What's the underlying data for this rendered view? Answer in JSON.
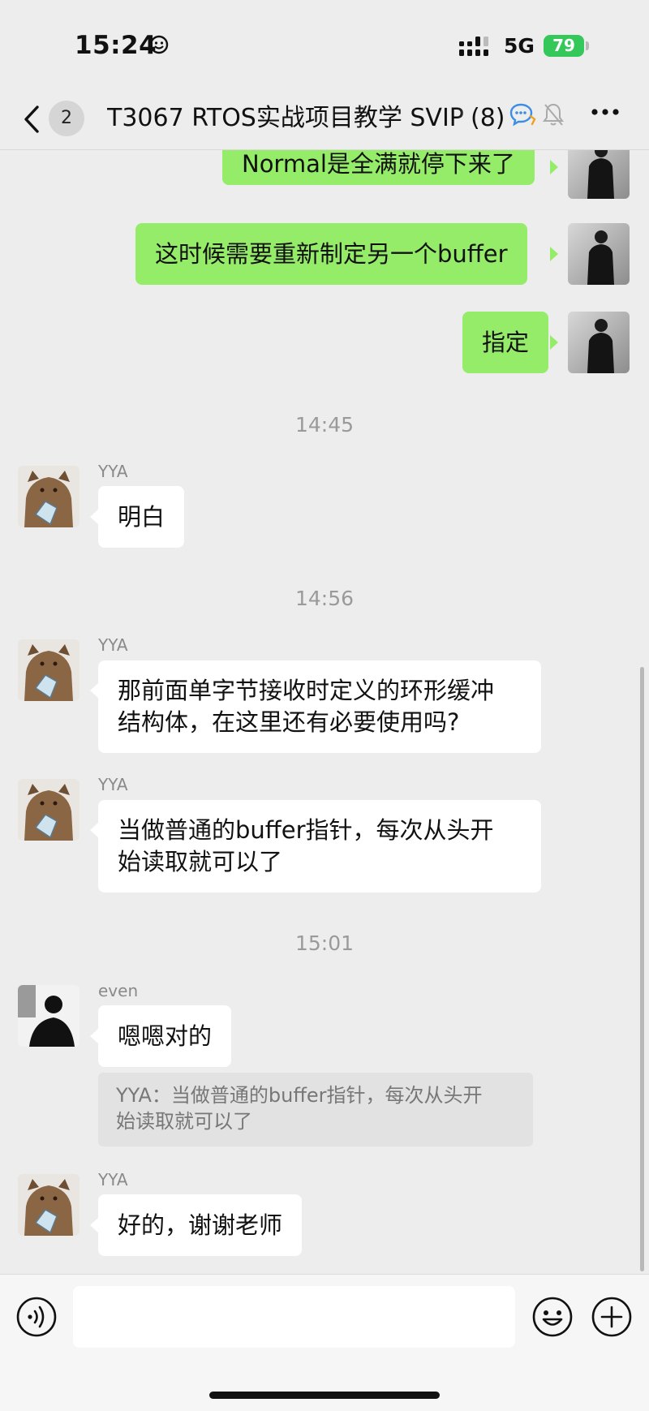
{
  "status_bar": {
    "time": "15:24",
    "network": "5G",
    "battery": "79"
  },
  "header": {
    "back_badge": "2",
    "title": "T3067 RTOS实战项目教学 SVIP",
    "member_count": "(8)"
  },
  "messages": [
    {
      "type": "out",
      "text": "Normal是全满就停下来了"
    },
    {
      "type": "out",
      "text": "这时候需要重新制定另一个buffer"
    },
    {
      "type": "out",
      "text": "指定"
    },
    {
      "type": "time",
      "text": "14:45"
    },
    {
      "type": "in",
      "sender": "YYA",
      "text": "明白"
    },
    {
      "type": "time",
      "text": "14:56"
    },
    {
      "type": "in",
      "sender": "YYA",
      "line1": "那前面单字节接收时定义的环形缓冲",
      "line2": "结构体，在这里还有必要使用吗?"
    },
    {
      "type": "in",
      "sender": "YYA",
      "line1": "当做普通的buffer指针，每次从头开",
      "line2": "始读取就可以了"
    },
    {
      "type": "time",
      "text": "15:01"
    },
    {
      "type": "in",
      "sender": "even",
      "text": "嗯嗯对的",
      "quote_line1": "YYA：当做普通的buffer指针，每次从头开",
      "quote_line2": "始读取就可以了"
    },
    {
      "type": "in",
      "sender": "YYA",
      "text": "好的，谢谢老师"
    }
  ],
  "input": {
    "value": "",
    "placeholder": ""
  },
  "icons": {
    "back": "chevron-left-icon",
    "chat_bubble": "chat-bubble-icon",
    "mute": "bell-mute-icon",
    "more": "more-icon",
    "voice": "voice-icon",
    "emoji": "emoji-icon",
    "plus": "plus-icon"
  },
  "colors": {
    "background": "#ededed",
    "bubble_out": "#95ec69",
    "bubble_in": "#ffffff",
    "battery": "#34c759"
  }
}
